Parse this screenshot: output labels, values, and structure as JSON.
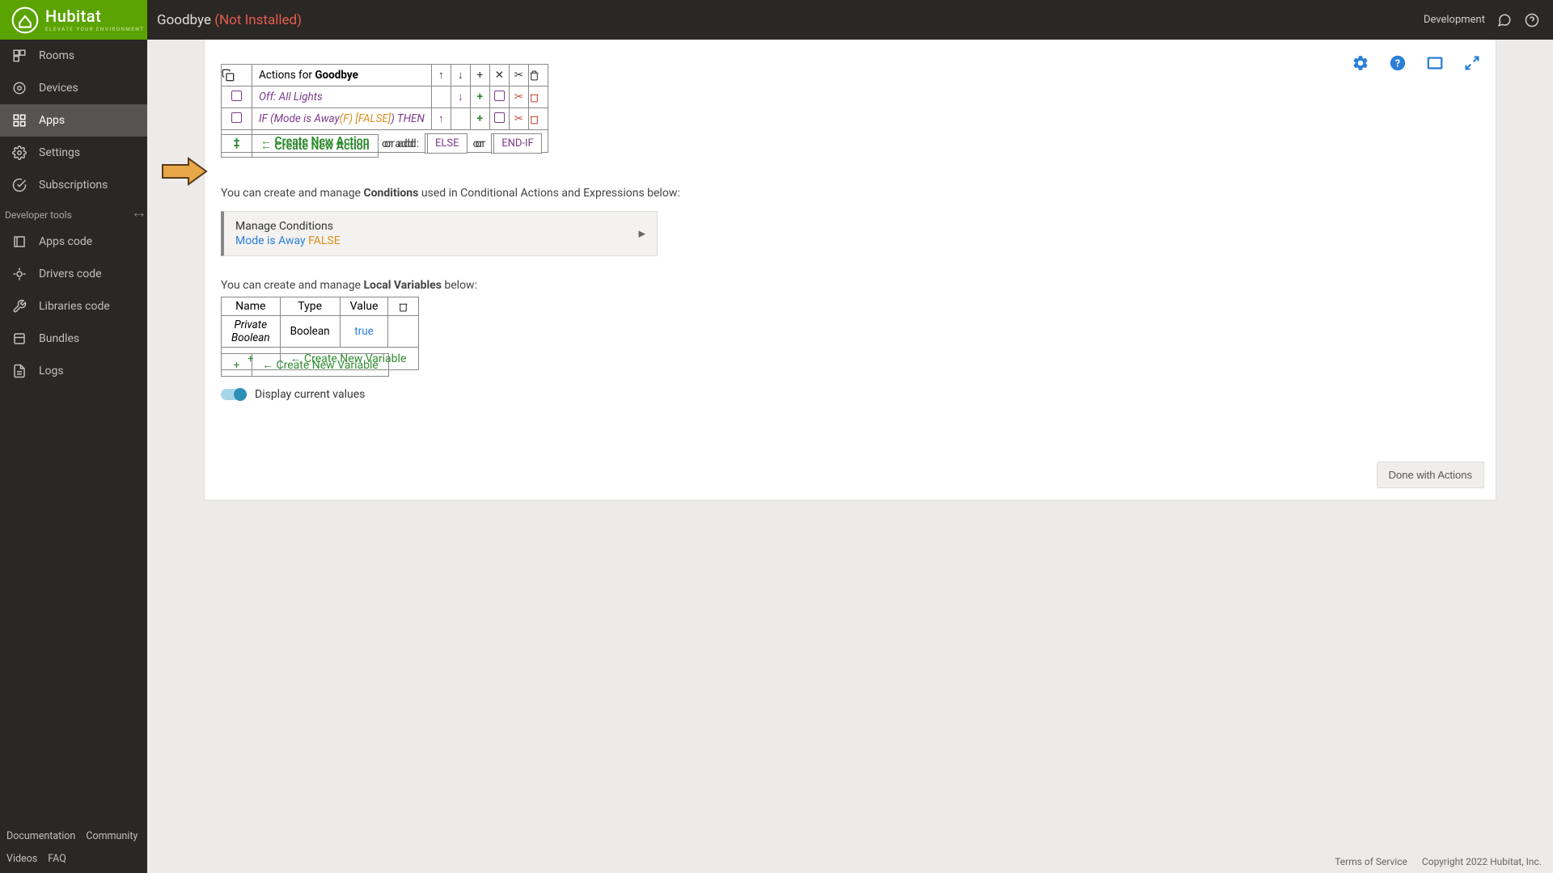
{
  "brand": {
    "name": "Hubitat",
    "tagline": "ELEVATE YOUR ENVIRONMENT"
  },
  "header": {
    "title": "Goodbye",
    "status": "(Not Installed)",
    "dev_label": "Development"
  },
  "sidebar": {
    "items": [
      {
        "label": "Rooms"
      },
      {
        "label": "Devices"
      },
      {
        "label": "Apps"
      },
      {
        "label": "Settings"
      },
      {
        "label": "Subscriptions"
      }
    ],
    "dev_header": "Developer tools",
    "dev_items": [
      {
        "label": "Apps code"
      },
      {
        "label": "Drivers code"
      },
      {
        "label": "Libraries code"
      },
      {
        "label": "Bundles"
      },
      {
        "label": "Logs"
      }
    ],
    "footer": [
      "Documentation",
      "Community",
      "Videos",
      "FAQ"
    ]
  },
  "actions": {
    "title_prefix": "Actions for ",
    "title_bold": "Goodbye",
    "rows": [
      {
        "text": "Off: All Lights"
      },
      {
        "if_prefix": "IF (Mode is Away",
        "f_tag": "(F)",
        "false_tag": " [FALSE]",
        "then": ") THEN"
      }
    ],
    "create_label": "← Create New Action",
    "or_add": "or add:",
    "else": "ELSE",
    "or": "or",
    "endif": "END-IF"
  },
  "conditions": {
    "intro_a": "You can create and manage ",
    "intro_b": "Conditions",
    "intro_c": " used in Conditional Actions and Expressions below:",
    "title": "Manage Conditions",
    "sub_a": "Mode is Away ",
    "sub_false": "FALSE"
  },
  "variables": {
    "intro_a": "You can create and manage ",
    "intro_b": "Local Variables",
    "intro_c": " below:",
    "headers": {
      "name": "Name",
      "type": "Type",
      "value": "Value"
    },
    "row": {
      "name": "Private Boolean",
      "type": "Boolean",
      "value": "true"
    },
    "create_label": "← Create New Variable"
  },
  "toggle": {
    "label": "Display current values"
  },
  "done": "Done with Actions",
  "legal": {
    "tos": "Terms of Service",
    "copyright": "Copyright 2022 Hubitat, Inc."
  }
}
